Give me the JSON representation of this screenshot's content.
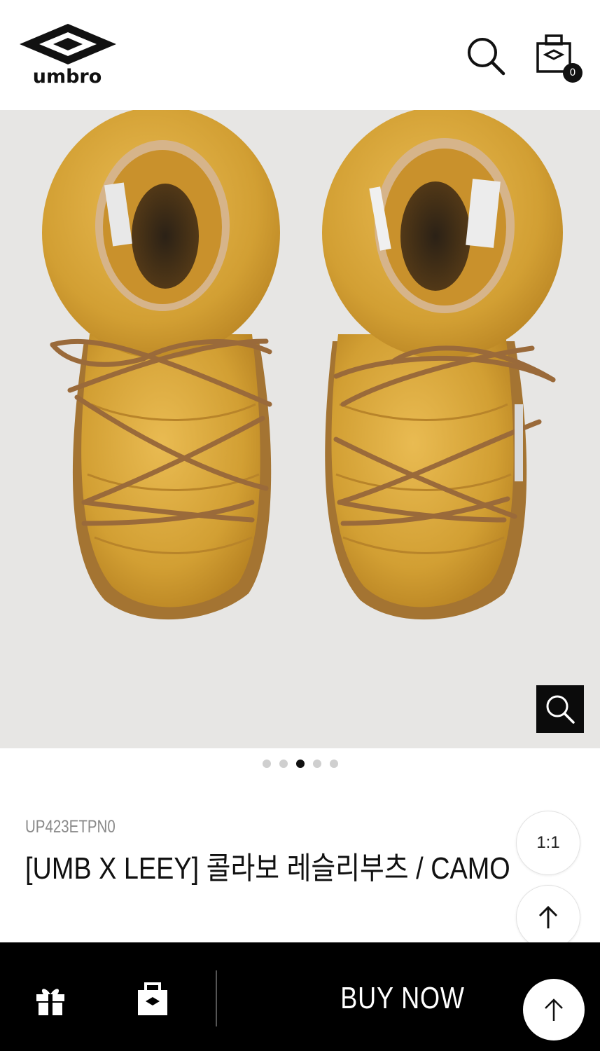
{
  "header": {
    "brand": "umbro",
    "cart_count": "0"
  },
  "gallery": {
    "slide_count": 5,
    "active_index": 2
  },
  "product": {
    "sku": "UP423ETPN0",
    "title": "[UMB X LEEY] 콜라보 레슬리부츠 / CAMO"
  },
  "floating": {
    "ratio_label": "1:1"
  },
  "bottom_bar": {
    "buy_label": "BUY NOW"
  },
  "icons": [
    "search-icon",
    "cart-icon",
    "zoom-icon",
    "gift-icon",
    "bag-icon",
    "arrow-up-icon"
  ],
  "colors": {
    "bar_background": "#000000",
    "boot_mustard": "#d7a53a",
    "lace_brown": "#9a6a3a",
    "image_background": "#e7e6e4"
  }
}
